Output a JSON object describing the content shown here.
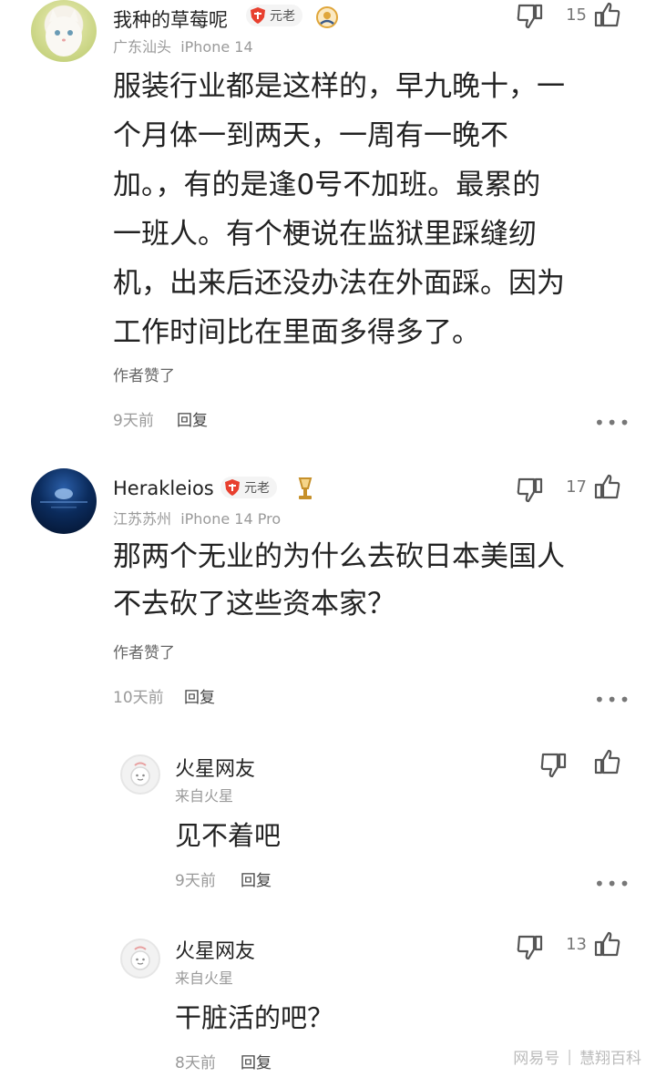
{
  "comments": [
    {
      "username": "我种的草莓呢",
      "badge": "元老",
      "location": "广东汕头",
      "device": "iPhone 14",
      "likes": "15",
      "lines": [
        "服装行业都是这样的，早九晚十，一",
        "个月体一到两天，一周有一晚不",
        "加。，有的是逢0号不加班。最累的",
        "一班人。有个梗说在监狱里踩缝纫",
        "机，出来后还没办法在外面踩。因为",
        "工作时间比在里面多得多了。"
      ],
      "author_liked": "作者赞了",
      "time": "9天前",
      "reply": "回复"
    },
    {
      "username": "Herakleios",
      "badge": "元老",
      "location": "江苏苏州",
      "device": "iPhone 14 Pro",
      "likes": "17",
      "lines": [
        "那两个无业的为什么去砍日本美国人",
        "不去砍了这些资本家？"
      ],
      "author_liked": "作者赞了",
      "time": "10天前",
      "reply": "回复"
    }
  ],
  "replies": [
    {
      "username": "火星网友",
      "source": "来自火星",
      "text": "见不着吧",
      "likes": "",
      "time": "9天前",
      "reply": "回复"
    },
    {
      "username": "火星网友",
      "source": "来自火星",
      "text": "干脏活的吧？",
      "likes": "13",
      "time": "8天前",
      "reply": "回复"
    }
  ],
  "more_label": "•••",
  "watermark": {
    "brand": "网易号",
    "account": "慧翔百科"
  },
  "colors": {
    "badge_red": "#e8402f",
    "text": "#222222",
    "meta": "#9a9a9a"
  },
  "icons": [
    "dislike-icon",
    "like-icon",
    "shield-badge-icon",
    "rank-medal-icon",
    "more-icon"
  ]
}
